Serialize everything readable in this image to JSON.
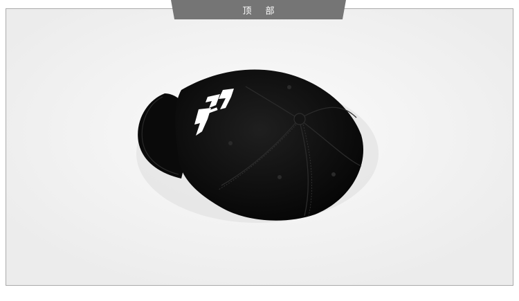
{
  "header": {
    "title": "顶部"
  },
  "photo": {
    "subject": "black-baseball-cap-top-view",
    "background": "#f2f2f2",
    "cap_color": "#0d0d0d",
    "logo_color": "#ffffff"
  }
}
